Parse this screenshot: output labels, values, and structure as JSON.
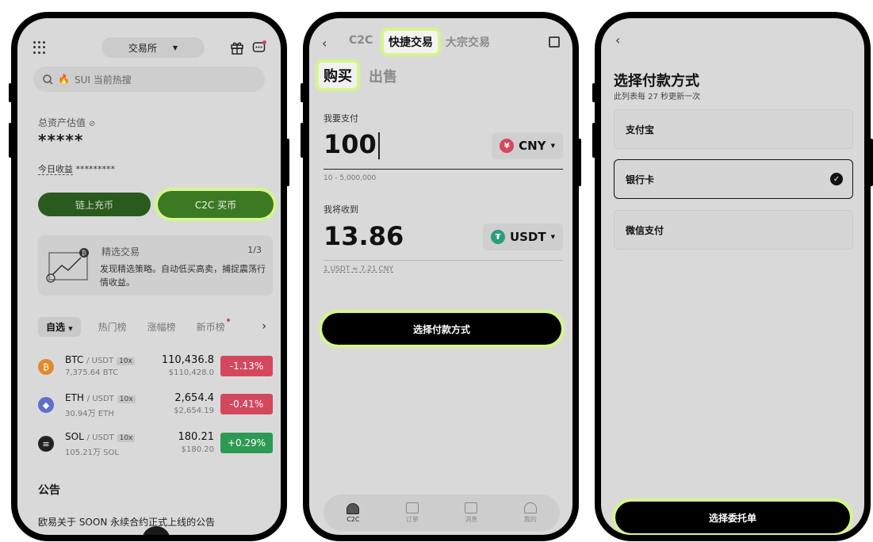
{
  "phone1": {
    "exchange_tab": "交易所",
    "search_placeholder": "SUI 当前热搜",
    "asset_label": "总资产估值",
    "asset_value": "*****",
    "today_label": "今日收益",
    "today_value": "*********",
    "btn_onchain": "链上充币",
    "btn_c2c": "C2C 买币",
    "promo_title": "精选交易",
    "promo_count": "1/3",
    "promo_desc": "发现精选策略。自动低买高卖，捕捉震荡行情收益。",
    "filters": [
      "自选",
      "热门榜",
      "涨幅榜",
      "新币榜"
    ],
    "coins": [
      {
        "symbol": "BTC",
        "quote": "/ USDT",
        "lev": "10x",
        "vol": "7,375.64 BTC",
        "price": "110,436.8",
        "fiat": "$110,428.0",
        "change": "-1.13%"
      },
      {
        "symbol": "ETH",
        "quote": "/ USDT",
        "lev": "10x",
        "vol": "30.94万 ETH",
        "price": "2,654.4",
        "fiat": "$2,654.19",
        "change": "-0.41%"
      },
      {
        "symbol": "SOL",
        "quote": "/ USDT",
        "lev": "10x",
        "vol": "105.21万 SOL",
        "price": "180.21",
        "fiat": "$180.20",
        "change": "+0.29%"
      }
    ],
    "announcement_title": "公告",
    "announcement_item": "欧易关于 SOON 永续合约正式上线的公告"
  },
  "phone2": {
    "tabs": [
      "C2C",
      "快捷交易",
      "大宗交易"
    ],
    "buy_tab": "购买",
    "sell_tab": "出售",
    "pay_label": "我要支付",
    "pay_amount": "100",
    "pay_currency": "CNY",
    "pay_range": "10 - 5,000,000",
    "receive_label": "我将收到",
    "receive_amount": "13.86",
    "receive_currency": "USDT",
    "rate": "1 USDT ≈ 7.21 CNY",
    "pay_button": "选择付款方式",
    "nav": [
      "C2C",
      "订单",
      "消息",
      "我的"
    ]
  },
  "phone3": {
    "title": "选择付款方式",
    "subtitle": "此列表每 27 秒更新一次",
    "options": [
      "支付宝",
      "银行卡",
      "微信支付"
    ],
    "order_button": "选择委托单"
  },
  "colors": {
    "accent_green": "#3b7a23",
    "highlight": "#d5f78a",
    "down_red": "#d4485d",
    "up_green": "#2c9a54"
  }
}
